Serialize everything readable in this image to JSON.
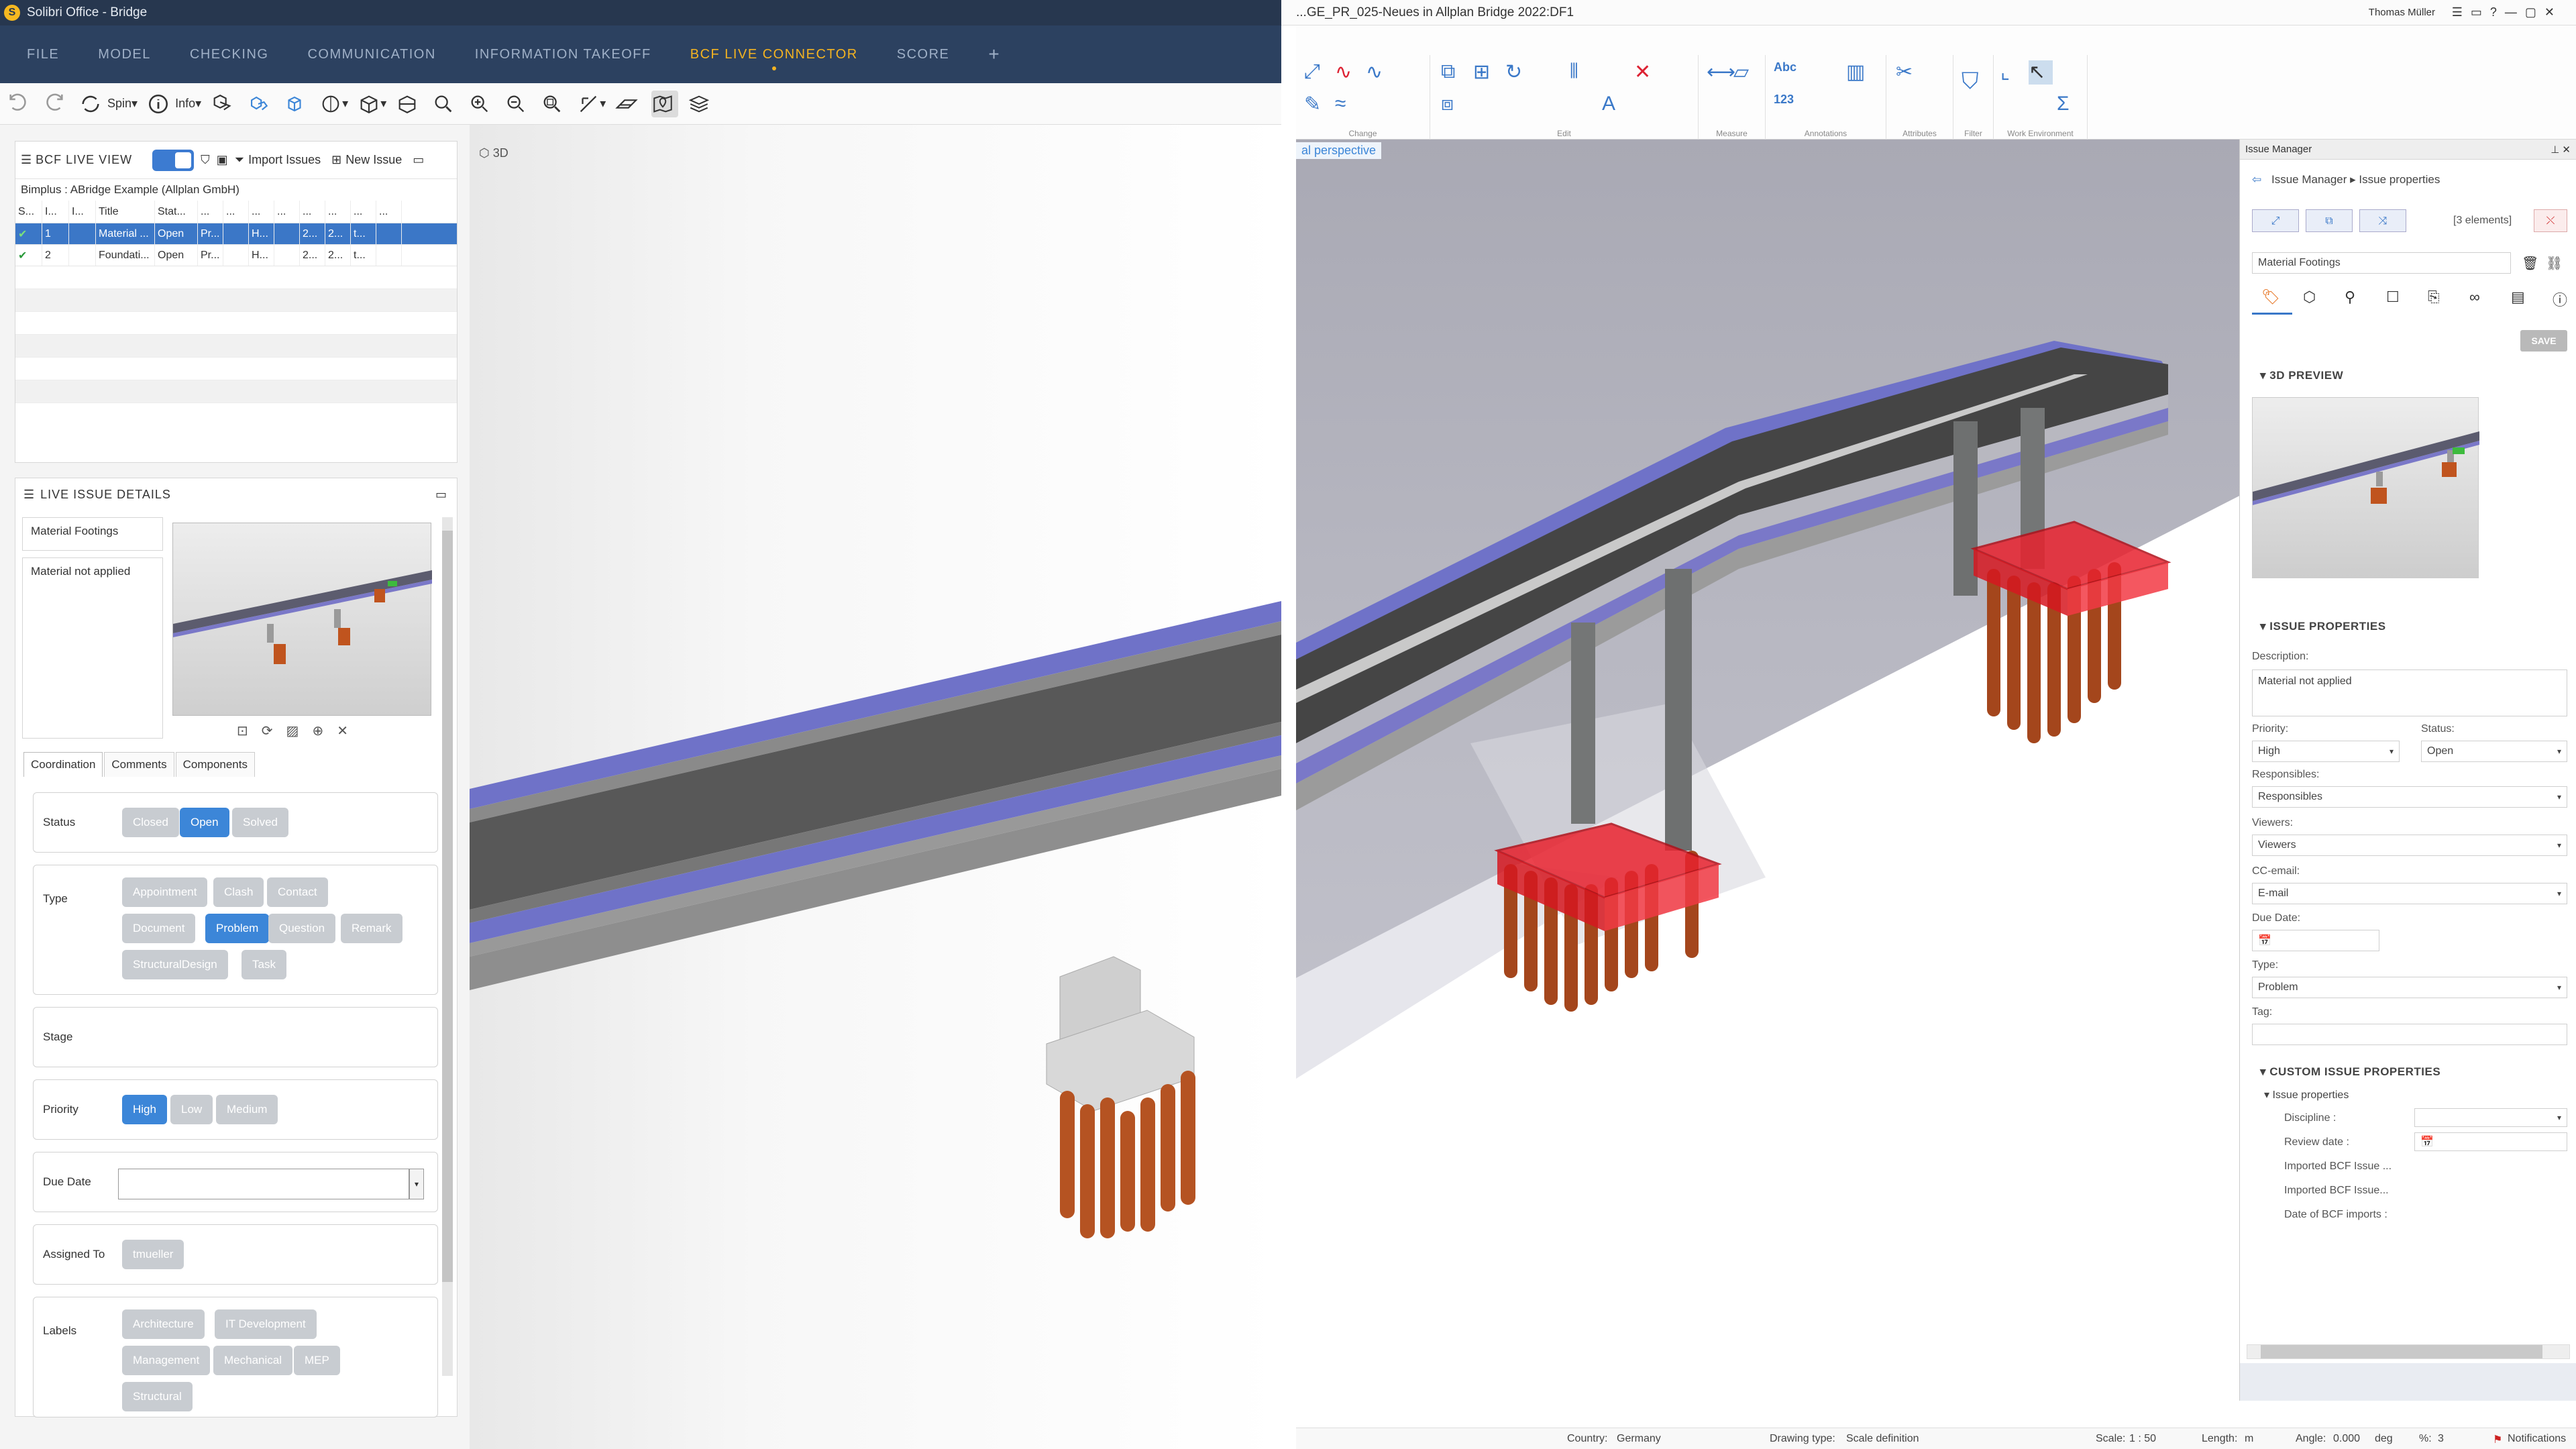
{
  "left_app": {
    "title": "Solibri Office - Bridge",
    "logo_letter": "S",
    "menu": [
      "FILE",
      "MODEL",
      "CHECKING",
      "COMMUNICATION",
      "INFORMATION TAKEOFF",
      "BCF LIVE CONNECTOR",
      "SCORE"
    ],
    "menu_active_index": 5,
    "toolbar": {
      "spin_label": "Spin",
      "info_label": "Info"
    },
    "bcf_view": {
      "title": "BCF LIVE VIEW",
      "import_label": "Import Issues",
      "new_label": "New Issue",
      "project": "Bimplus : ABridge Example (Allplan GmbH)",
      "columns": [
        "S...",
        "I...",
        "I...",
        "Title",
        "Stat...",
        "...",
        "...",
        "...",
        "...",
        "...",
        "...",
        "...",
        "..."
      ],
      "rows": [
        [
          "✔",
          "1",
          "",
          "Material ...",
          "Open",
          "Pr...",
          "",
          "H...",
          "",
          "2...",
          "2...",
          "t...",
          ""
        ],
        [
          "✔",
          "2",
          "",
          "Foundati...",
          "Open",
          "Pr...",
          "",
          "H...",
          "",
          "2...",
          "2...",
          "t...",
          ""
        ]
      ]
    },
    "live_details": {
      "title": "LIVE ISSUE DETAILS",
      "issue_title": "Material Footings",
      "description": "Material not applied",
      "tabs": [
        "Coordination",
        "Comments",
        "Components"
      ],
      "status_label": "Status",
      "status_options": [
        "Closed",
        "Open",
        "Solved"
      ],
      "type_label": "Type",
      "type_options": [
        "Appointment",
        "Clash",
        "Contact",
        "Document",
        "Problem",
        "Question",
        "Remark",
        "StructuralDesign",
        "Task"
      ],
      "stage_label": "Stage",
      "priority_label": "Priority",
      "priority_options": [
        "High",
        "Low",
        "Medium"
      ],
      "due_label": "Due Date",
      "assigned_label": "Assigned To",
      "assigned_value": "tmueller",
      "labels_label": "Labels",
      "labels_options": [
        "Architecture",
        "IT Development",
        "Management",
        "Mechanical",
        "MEP",
        "Structural"
      ]
    },
    "viewport_label": "3D"
  },
  "right_app": {
    "title": "...GE_PR_025-Neues in Allplan Bridge 2022:DF1",
    "user": "Thomas Müller",
    "ribbon_groups": [
      "Change",
      "Edit",
      "Measure",
      "Annotations",
      "Attributes",
      "Filter",
      "Work Environment"
    ],
    "viewport_label": "al perspective",
    "issue_manager": {
      "header": "Issue Manager",
      "breadcrumb_root": "Issue Manager",
      "breadcrumb_leaf": "Issue properties",
      "elements_count": "[3 elements]",
      "title_value": "Material Footings",
      "save_label": "SAVE",
      "preview_header": "3D PREVIEW",
      "props_header": "ISSUE PROPERTIES",
      "description_label": "Description:",
      "description_value": "Material not applied",
      "priority_label": "Priority:",
      "priority_value": "High",
      "status_label": "Status:",
      "status_value": "Open",
      "responsibles_label": "Responsibles:",
      "responsibles_value": "Responsibles",
      "viewers_label": "Viewers:",
      "viewers_value": "Viewers",
      "cc_label": "CC-email:",
      "cc_value": "E-mail",
      "due_label": "Due Date:",
      "type_label": "Type:",
      "type_value": "Problem",
      "tag_label": "Tag:",
      "custom_header": "CUSTOM ISSUE PROPERTIES",
      "issue_props_sub": "Issue properties",
      "discipline_label": "Discipline :",
      "review_label": "Review date :",
      "imported1_label": "Imported BCF Issue ...",
      "imported2_label": "Imported BCF Issue...",
      "date_imports_label": "Date of BCF imports :"
    },
    "status_bar": {
      "country_label": "Country:",
      "country_value": "Germany",
      "drawing_label": "Drawing type:",
      "drawing_value": "Scale definition",
      "scale_label": "Scale:",
      "scale_value": "1 : 50",
      "length_label": "Length:",
      "length_value": "m",
      "angle_label": "Angle:",
      "angle_value": "0.000",
      "angle_unit": "deg",
      "pct_label": "%:",
      "pct_value": "3",
      "notifications": "Notifications"
    }
  },
  "colors": {
    "accent": "#3c86d8",
    "menu_active": "#f4b321",
    "title_bar": "#27374f",
    "clash_red": "#e8222e",
    "piles": "#a4461c"
  }
}
